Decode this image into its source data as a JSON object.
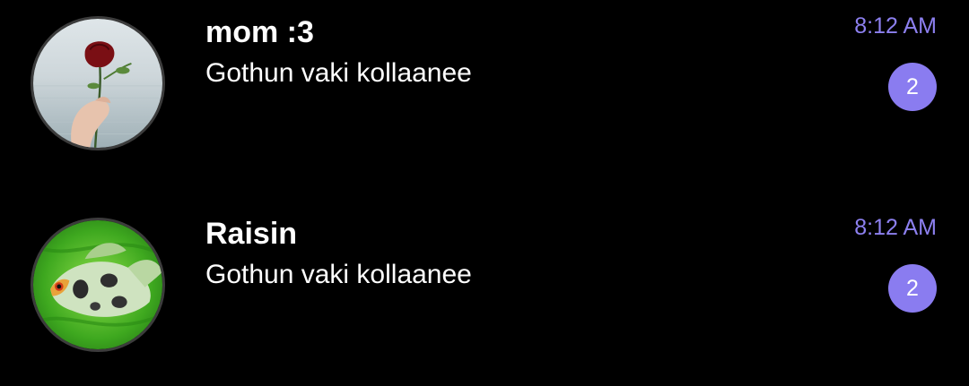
{
  "chats": [
    {
      "name": "mom :3",
      "preview": "Gothun vaki kollaanee",
      "time": "8:12 AM",
      "unread": "2",
      "avatar": "rose-in-hand-over-sea-photo"
    },
    {
      "name": "Raisin",
      "preview": "Gothun vaki kollaanee",
      "time": "8:12 AM",
      "unread": "2",
      "avatar": "green-fish-photo"
    }
  ],
  "colors": {
    "background": "#000000",
    "accent": "#8a7cf0",
    "time_text": "#8d80f0",
    "primary_text": "#ffffff"
  }
}
